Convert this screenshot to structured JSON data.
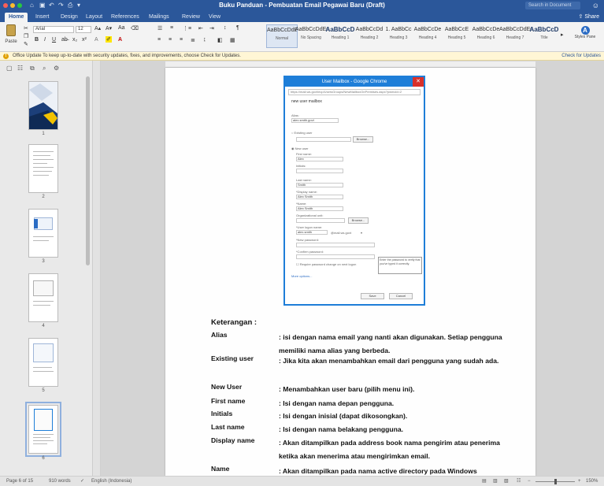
{
  "window": {
    "title": "Buku Panduan - Pembuatan Email Pegawai Baru (Draft)",
    "search_placeholder": "Search in Document",
    "colors": {
      "brand": "#2b579a",
      "close": "#fc5f57",
      "min": "#fdbc2e",
      "max": "#27c840"
    }
  },
  "tabs": [
    {
      "label": "Home"
    },
    {
      "label": "Insert"
    },
    {
      "label": "Design"
    },
    {
      "label": "Layout"
    },
    {
      "label": "References"
    },
    {
      "label": "Mailings"
    },
    {
      "label": "Review"
    },
    {
      "label": "View"
    }
  ],
  "share_label": "Share",
  "ribbon": {
    "paste_label": "Paste",
    "font_name": "Arial",
    "font_size": "12",
    "styles": [
      {
        "sample": "AaBbCcDdEe",
        "name": "Normal"
      },
      {
        "sample": "AaBbCcDdEe",
        "name": "No Spacing"
      },
      {
        "sample": "AaBbCcD",
        "name": "Heading 1"
      },
      {
        "sample": "AaBbCcDd",
        "name": "Heading 2"
      },
      {
        "sample": "1. AaBbCc",
        "name": "Heading 3"
      },
      {
        "sample": "AaBbCcDe",
        "name": "Heading 4"
      },
      {
        "sample": "AaBbCcE",
        "name": "Heading 5"
      },
      {
        "sample": "AaBbCcDe",
        "name": "Heading 6"
      },
      {
        "sample": "AaBbCcDdEe",
        "name": "Heading 7"
      },
      {
        "sample": "AaBbCcD",
        "name": "Title"
      }
    ],
    "styles_pane_label": "Styles Pane"
  },
  "message_bar": {
    "text": "Office Update  To keep up-to-date with security updates, fixes, and improvements, choose Check for Updates.",
    "link": "Check for Updates"
  },
  "nav": {
    "page_numbers": [
      "1",
      "2",
      "3",
      "4",
      "5",
      "6"
    ]
  },
  "dialog": {
    "title": "User Mailbox - Google Chrome",
    "url": "https://mail.ws.govt/ecp/UsersGroups/NewMailboxOnPremises.aspx?pwmcid=2",
    "header": "new user mailbox",
    "alias_label": "Alias:",
    "alias_value": "alex.smith.govt",
    "existing_user": "Existing user",
    "browse_label": "Browse...",
    "new_user": "New user",
    "first_name_label": "First name:",
    "first_name_value": "Alex",
    "initials_label": "Initials:",
    "last_name_label": "Last name:",
    "last_name_value": "Smith",
    "display_name_label": "*Display name:",
    "display_name_value": "Alex Smith",
    "name_label": "*Name:",
    "name_value": "Alex Smith",
    "ou_label": "Organizational unit:",
    "logon_label": "*User logon name:",
    "logon_value": "alex.smith",
    "domain_value": "@mail.ws.govt",
    "password_label": "*New password:",
    "confirm_label": "*Confirm password:",
    "require_change": "Require password change on next logon",
    "more_options": "More options...",
    "tooltip": "Enter the password to verify that you've typed it correctly.",
    "save_label": "Save",
    "cancel_label": "Cancel"
  },
  "doc": {
    "heading": "Keterangan :",
    "rows": [
      {
        "term": "Alias",
        "desc": ": isi dengan nama email yang nanti akan digunakan. Setiap pengguna memiliki nama alias yang berbeda."
      },
      {
        "term": "Existing user",
        "desc": ": Jika kita akan menambahkan email dari pengguna yang sudah ada."
      },
      {
        "term": "New User",
        "desc": ": Menambahkan user baru (pilih menu ini)."
      },
      {
        "term": "First name",
        "desc": ": Isi dengan nama depan pengguna."
      },
      {
        "term": "Initials",
        "desc": ": Isi dengan inisial (dapat dikosongkan)."
      },
      {
        "term": "Last name",
        "desc": ": Isi dengan nama belakang pengguna."
      },
      {
        "term": "Display name",
        "desc": ": Akan ditampilkan pada address book nama pengirim atau penerima ketika akan menerima atau mengirimkan email."
      },
      {
        "term": "Name",
        "desc": ": Akan ditampilkan pada nama active directory pada Windows"
      }
    ]
  },
  "status": {
    "page": "Page 6 of 15",
    "words": "910 words",
    "language": "English (Indonesia)",
    "zoom": "150%"
  }
}
